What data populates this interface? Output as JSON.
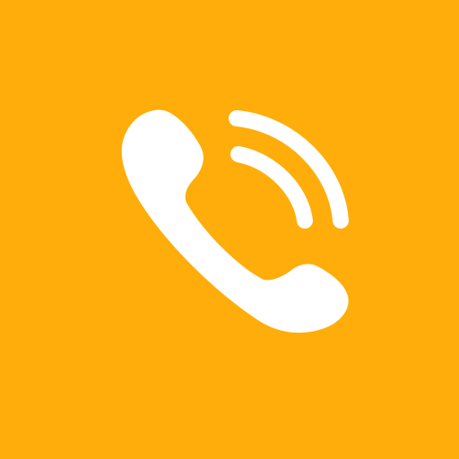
{
  "app_icon": {
    "icon": "phone-call-icon",
    "background_color": "#FFAD0A",
    "glyph_color": "#FFFFFF",
    "signal_waves": 2
  }
}
